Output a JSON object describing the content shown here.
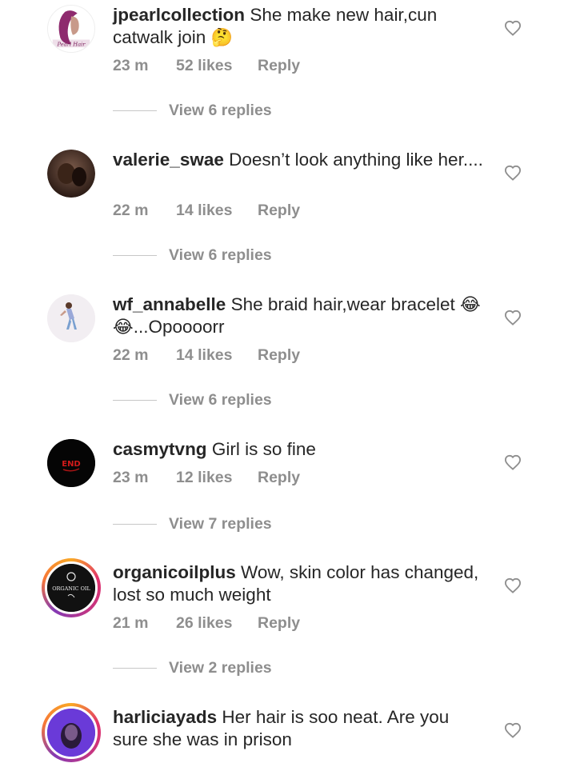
{
  "comments": [
    {
      "username": "jpearlcollection",
      "text": "She make new hair,cun catwalk join",
      "emoji": "🤔",
      "time": "23 m",
      "likes": "52 likes",
      "reply": "Reply",
      "view_replies": "View 6 replies",
      "avatar_text": "Pearl Hair"
    },
    {
      "username": "valerie_swae",
      "text": "Doesn’t look anything like her....",
      "emoji": "",
      "time": "22 m",
      "likes": "14 likes",
      "reply": "Reply",
      "view_replies": "View 6 replies"
    },
    {
      "username": "wf_annabelle",
      "text": "She braid hair,wear bracelet",
      "emoji": "😂😂",
      "text2": "...Opoooorr",
      "time": "22 m",
      "likes": "14 likes",
      "reply": "Reply",
      "view_replies": "View 6 replies"
    },
    {
      "username": "casmytvng",
      "text": "Girl is so fine",
      "emoji": "",
      "time": "23 m",
      "likes": "12 likes",
      "reply": "Reply",
      "view_replies": "View 7 replies",
      "avatar_text": "END"
    },
    {
      "username": "organicoilplus",
      "text": "Wow, skin color has changed, lost so much weight",
      "emoji": "",
      "time": "21 m",
      "likes": "26 likes",
      "reply": "Reply",
      "view_replies": "View 2 replies",
      "avatar_text": "ORGANIC OIL"
    },
    {
      "username": "harliciayads",
      "text": "Her hair is soo neat. Are you sure she was in prison",
      "emoji": "",
      "time": "",
      "likes": "",
      "reply": ""
    }
  ],
  "colors": {
    "text": "#262626",
    "meta": "#8e8e8e",
    "divider": "#c7c7c7",
    "heart": "#8e8e8e"
  },
  "icons": {
    "like": "heart-outline-icon"
  }
}
